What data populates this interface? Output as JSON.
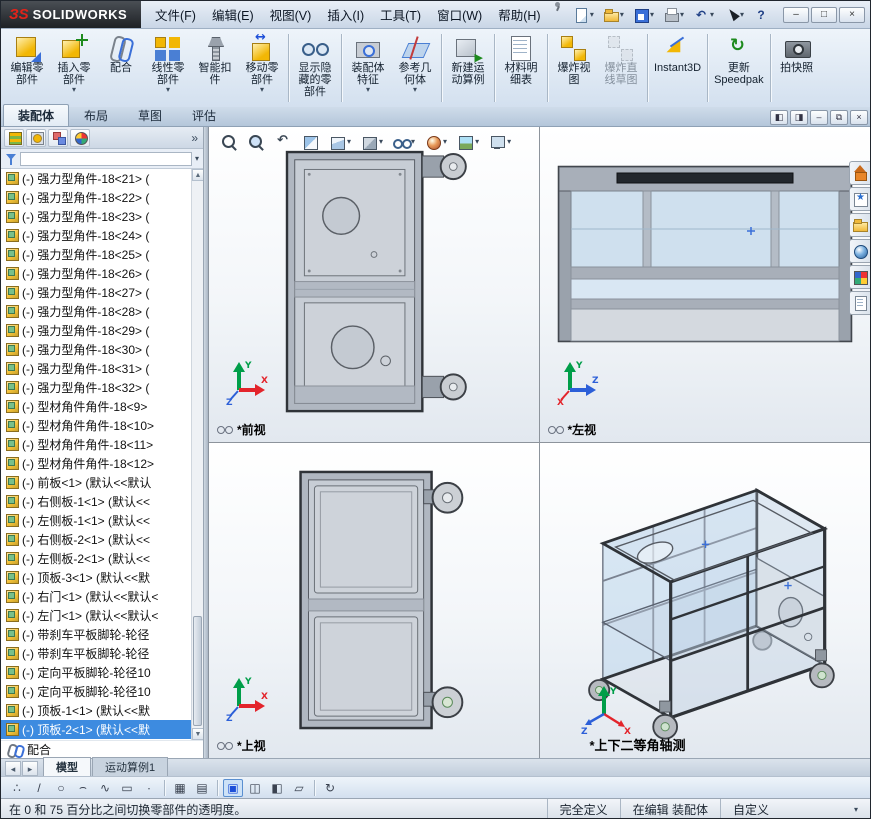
{
  "titlebar": {
    "brand_mark": "ЗS",
    "brand_name": "SOLIDWORKS",
    "menus": [
      "文件(F)",
      "编辑(E)",
      "视图(V)",
      "插入(I)",
      "工具(T)",
      "窗口(W)",
      "帮助(H)"
    ],
    "quick_icons": [
      {
        "icon": "new-document-icon",
        "dropdown": true
      },
      {
        "icon": "open-icon",
        "dropdown": true
      },
      {
        "icon": "save-icon",
        "dropdown": true
      },
      {
        "icon": "print-icon",
        "dropdown": true
      },
      {
        "icon": "undo-icon",
        "glyph": "↶",
        "dropdown": true
      },
      {
        "icon": "select-arrow-icon",
        "dropdown": true
      },
      {
        "icon": "help-icon",
        "glyph": "?"
      }
    ],
    "window_buttons": [
      {
        "name": "minimize-button",
        "glyph": "–"
      },
      {
        "name": "maximize-button",
        "glyph": "□"
      },
      {
        "name": "close-button",
        "glyph": "×"
      }
    ]
  },
  "ribbon": {
    "buttons": [
      {
        "label": "编辑零\n部件",
        "icon": "edit-component-icon"
      },
      {
        "label": "插入零\n部件",
        "icon": "insert-component-icon",
        "dropdown": true
      },
      {
        "label": "配合",
        "icon": "mate-icon"
      },
      {
        "label": "线性零\n部件",
        "icon": "linear-pattern-icon",
        "dropdown": true
      },
      {
        "label": "智能扣\n件",
        "icon": "smart-fasteners-icon"
      },
      {
        "label": "移动零\n部件",
        "icon": "move-component-icon",
        "dropdown": true
      },
      {
        "sep": true
      },
      {
        "label": "显示隐\n藏的零\n部件",
        "icon": "show-hidden-icon"
      },
      {
        "sep": true
      },
      {
        "label": "装配体\n特征",
        "icon": "assembly-features-icon",
        "dropdown": true
      },
      {
        "label": "参考几\n何体",
        "icon": "reference-geometry-icon",
        "dropdown": true
      },
      {
        "sep": true
      },
      {
        "label": "新建运\n动算例",
        "icon": "new-motion-study-icon"
      },
      {
        "sep": true
      },
      {
        "label": "材料明\n细表",
        "icon": "bom-icon"
      },
      {
        "sep": true
      },
      {
        "label": "爆炸视\n图",
        "icon": "exploded-view-icon"
      },
      {
        "label": "爆炸直\n线草图",
        "icon": "explode-line-sketch-icon",
        "disabled": true
      },
      {
        "sep": true
      },
      {
        "label": "Instant3D",
        "icon": "instant3d-icon"
      },
      {
        "sep": true
      },
      {
        "label": "更新\nSpeedpak",
        "icon": "update-speedpak-icon"
      },
      {
        "sep": true
      },
      {
        "label": "拍快照",
        "icon": "snapshot-icon"
      }
    ]
  },
  "command_tabs": [
    {
      "label": "装配体",
      "active": true
    },
    {
      "label": "布局"
    },
    {
      "label": "草图"
    },
    {
      "label": "评估"
    }
  ],
  "doc_window_buttons": [
    {
      "name": "tile-left-button",
      "glyph": "◧"
    },
    {
      "name": "tile-right-button",
      "glyph": "◨"
    },
    {
      "name": "doc-minimize-button",
      "glyph": "–"
    },
    {
      "name": "doc-restore-button",
      "glyph": "⧉"
    },
    {
      "name": "doc-close-button",
      "glyph": "×"
    }
  ],
  "feature_panel": {
    "tabs": [
      {
        "icon": "featuremanager-tab-icon"
      },
      {
        "icon": "propertymanager-tab-icon"
      },
      {
        "icon": "configurationmanager-tab-icon"
      },
      {
        "icon": "displaymanager-tab-icon"
      }
    ],
    "chevron": "»",
    "filter": {
      "value": "",
      "placeholder": ""
    },
    "tree": [
      {
        "text": "(-) 强力型角件-18<21> ("
      },
      {
        "text": "(-) 强力型角件-18<22> ("
      },
      {
        "text": "(-) 强力型角件-18<23> ("
      },
      {
        "text": "(-) 强力型角件-18<24> ("
      },
      {
        "text": "(-) 强力型角件-18<25> ("
      },
      {
        "text": "(-) 强力型角件-18<26> ("
      },
      {
        "text": "(-) 强力型角件-18<27> ("
      },
      {
        "text": "(-) 强力型角件-18<28> ("
      },
      {
        "text": "(-) 强力型角件-18<29> ("
      },
      {
        "text": "(-) 强力型角件-18<30> ("
      },
      {
        "text": "(-) 强力型角件-18<31> ("
      },
      {
        "text": "(-) 强力型角件-18<32> ("
      },
      {
        "text": "(-) 型材角件角件-18<9>"
      },
      {
        "text": "(-) 型材角件角件-18<10>"
      },
      {
        "text": "(-) 型材角件角件-18<11>"
      },
      {
        "text": "(-) 型材角件角件-18<12>"
      },
      {
        "text": "(-) 前板<1> (默认<<默认"
      },
      {
        "text": "(-) 右侧板-1<1> (默认<<"
      },
      {
        "text": "(-) 左侧板-1<1> (默认<<"
      },
      {
        "text": "(-) 右侧板-2<1> (默认<<"
      },
      {
        "text": "(-) 左侧板-2<1> (默认<<"
      },
      {
        "text": "(-) 顶板-3<1> (默认<<默"
      },
      {
        "text": "(-) 右门<1> (默认<<默认<"
      },
      {
        "text": "(-) 左门<1> (默认<<默认<"
      },
      {
        "text": "(-) 带刹车平板脚轮-轮径"
      },
      {
        "text": "(-) 带刹车平板脚轮-轮径"
      },
      {
        "text": "(-) 定向平板脚轮-轮径10"
      },
      {
        "text": "(-) 定向平板脚轮-轮径10"
      },
      {
        "text": "(-) 顶板-1<1> (默认<<默"
      },
      {
        "text": "(-) 顶板-2<1> (默认<<默",
        "selected": true
      }
    ],
    "mates_label": "配合"
  },
  "hud": {
    "items": [
      {
        "icon": "zoom-fit-icon"
      },
      {
        "icon": "zoom-area-icon"
      },
      {
        "icon": "previous-view-icon"
      },
      {
        "icon": "section-view-icon"
      },
      {
        "icon": "view-orientation-icon",
        "dropdown": true
      },
      {
        "icon": "display-style-icon",
        "dropdown": true
      },
      {
        "icon": "hide-show-items-icon",
        "dropdown": true
      },
      {
        "icon": "edit-appearance-icon",
        "dropdown": true
      },
      {
        "icon": "apply-scene-icon",
        "dropdown": true
      },
      {
        "icon": "view-settings-icon",
        "dropdown": true
      }
    ]
  },
  "task_pane": {
    "items": [
      {
        "icon": "home-icon"
      },
      {
        "icon": "design-library-icon"
      },
      {
        "icon": "file-explorer-icon"
      },
      {
        "icon": "appearances-icon"
      },
      {
        "icon": "scenes-icon"
      },
      {
        "icon": "custom-properties-icon"
      }
    ]
  },
  "viewports": {
    "front": {
      "label": "*前视"
    },
    "left": {
      "label": "*左视"
    },
    "top": {
      "label": "*上视"
    },
    "iso": {
      "label": "*上下二等角轴测"
    }
  },
  "triads": {
    "front": {
      "up": {
        "label": "Y",
        "color": "#009e49"
      },
      "right": {
        "label": "X",
        "color": "#e3242b"
      },
      "diag": {
        "label": "Z",
        "color": "#2c5fd8"
      }
    },
    "left": {
      "up": {
        "label": "Y",
        "color": "#009e49"
      },
      "right": {
        "label": "Z",
        "color": "#2c5fd8"
      },
      "diag": {
        "label": "X",
        "color": "#e3242b"
      }
    },
    "top": {
      "up": {
        "label": "Y",
        "color": "#009e49"
      },
      "right": {
        "label": "X",
        "color": "#e3242b"
      },
      "diag": {
        "label": "Z",
        "color": "#2c5fd8"
      }
    },
    "iso": {
      "up": {
        "label": "Y",
        "color": "#009e49"
      },
      "right": {
        "label": "X",
        "color": "#e3242b"
      },
      "diag": {
        "label": "Z",
        "color": "#2c5fd8"
      }
    }
  },
  "model_tabs": {
    "nav": [
      {
        "glyph": "◂"
      },
      {
        "glyph": "▸"
      }
    ],
    "tabs": [
      {
        "label": "模型",
        "active": true
      },
      {
        "label": "运动算例1"
      }
    ]
  },
  "sketch_bar": {
    "items": [
      {
        "icon": "quick-snaps-icon",
        "glyph": "∴"
      },
      {
        "icon": "line-icon",
        "glyph": "/"
      },
      {
        "icon": "circle-icon",
        "glyph": "○"
      },
      {
        "icon": "arc-icon",
        "glyph": "⌢"
      },
      {
        "icon": "spline-icon",
        "glyph": "∿"
      },
      {
        "icon": "rectangle-icon",
        "glyph": "▭"
      },
      {
        "icon": "point-icon",
        "glyph": "∙"
      },
      {
        "sep": true
      },
      {
        "icon": "grid-icon",
        "glyph": "▦"
      },
      {
        "icon": "snap-icon",
        "glyph": "▤"
      },
      {
        "sep": true
      },
      {
        "icon": "shaded-view-icon",
        "glyph": "▣",
        "active": true
      },
      {
        "icon": "hidden-lines-icon",
        "glyph": "◫"
      },
      {
        "icon": "section-icon",
        "glyph": "◧"
      },
      {
        "icon": "perspective-icon",
        "glyph": "▱"
      },
      {
        "sep": true
      },
      {
        "icon": "rebuild-icon",
        "glyph": "↻"
      }
    ]
  },
  "status_bar": {
    "message": "在 0 和 75 百分比之间切换零部件的透明度。",
    "cells": [
      {
        "label": "完全定义"
      },
      {
        "label": "在编辑 装配体"
      },
      {
        "label": "自定义",
        "dropdown": true
      }
    ]
  }
}
